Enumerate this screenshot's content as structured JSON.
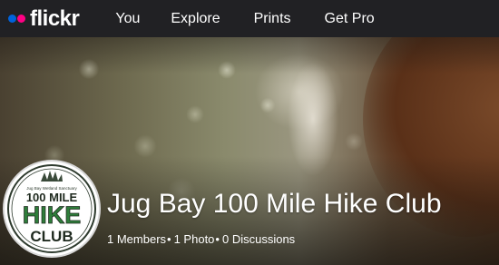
{
  "nav": {
    "logo": "flickr",
    "links": [
      "You",
      "Explore",
      "Prints",
      "Get Pro"
    ]
  },
  "colors": {
    "flickr_blue": "#0063dc",
    "flickr_pink": "#ff0084",
    "nav_bg": "#212124",
    "badge_green": "#2e7d3a"
  },
  "group": {
    "name": "Jug Bay 100 Mile Hike Club",
    "members": "1 Members",
    "photos": "1 Photo",
    "discussions": "0 Discussions",
    "separator": "•",
    "badge": {
      "top_text": "Jug Bay Wetland Sanctuary",
      "line1": "100 MILE",
      "line2": "HIKE",
      "line3": "CLUB"
    }
  }
}
